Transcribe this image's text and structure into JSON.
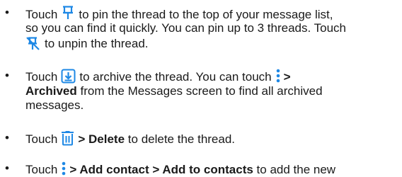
{
  "colors": {
    "accent": "#1e88e5",
    "text": "#1a1a1a"
  },
  "icons": {
    "pin": "pin-icon",
    "unpin": "unpin-icon",
    "archive": "archive-icon",
    "more": "more-vert-icon",
    "delete": "delete-icon"
  },
  "items": [
    {
      "bullet": "•",
      "t1": "Touch",
      "t2": "to pin the thread to the top of your message list,",
      "t3": "so you can find it quickly. You can pin up to 3 threads. Touch",
      "t4": "to unpin the thread."
    },
    {
      "bullet": "•",
      "t1": "Touch",
      "t2": "to archive the thread. You can touch",
      "t3": ">",
      "t4": "Archived",
      "t5": "from the Messages screen to find all archived",
      "t6": "messages."
    },
    {
      "bullet": "•",
      "t1": "Touch",
      "t2": "> Delete",
      "t3": "to delete the thread."
    },
    {
      "bullet": "•",
      "t1": "Touch",
      "t2": "> Add contact > Add to contacts",
      "t3": "to add the new"
    }
  ]
}
